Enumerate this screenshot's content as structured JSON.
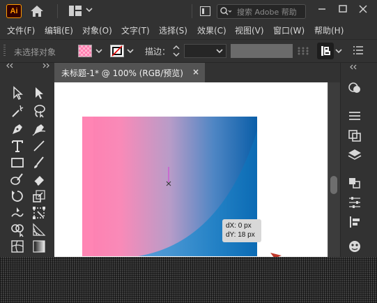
{
  "app": {
    "logo_text": "Ai",
    "search_placeholder": "搜索 Adobe 帮助"
  },
  "menu": [
    {
      "label": "文件(F)"
    },
    {
      "label": "编辑(E)"
    },
    {
      "label": "对象(O)"
    },
    {
      "label": "文字(T)"
    },
    {
      "label": "选择(S)"
    },
    {
      "label": "效果(C)"
    },
    {
      "label": "视图(V)"
    },
    {
      "label": "窗口(W)"
    },
    {
      "label": "帮助(H)"
    }
  ],
  "control": {
    "selection_status": "未选择对象",
    "stroke_label": "描边：",
    "stroke_value": ""
  },
  "document": {
    "tab_title": "未标题-1* @ 100% (RGB/预览)",
    "close_glyph": "×"
  },
  "tooltip": {
    "dx": "dX: 0 px",
    "dy": "dY: 18 px"
  },
  "colors": {
    "accent_orange": "#ff9a00",
    "gradient_start": "#ff7fb0",
    "gradient_mid": "#b89cc8",
    "gradient_end": "#0a6fb5"
  },
  "tools": [
    "selection-tool",
    "direct-selection-tool",
    "magic-wand-tool",
    "lasso-tool",
    "pen-tool",
    "curvature-tool",
    "type-tool",
    "line-tool",
    "rectangle-tool",
    "paintbrush-tool",
    "blob-brush-tool",
    "eraser-tool",
    "rotate-tool",
    "scale-tool",
    "warp-tool",
    "free-transform-tool",
    "shape-builder-tool",
    "perspective-grid-tool",
    "mesh-tool",
    "gradient-tool",
    "eyedropper-tool",
    "blend-tool"
  ],
  "dock": [
    "appearance-panel",
    "properties-panel",
    "transform-panel",
    "layers-panel",
    "pathfinder-panel",
    "align-panel",
    "distribute-panel",
    "libraries-panel"
  ]
}
